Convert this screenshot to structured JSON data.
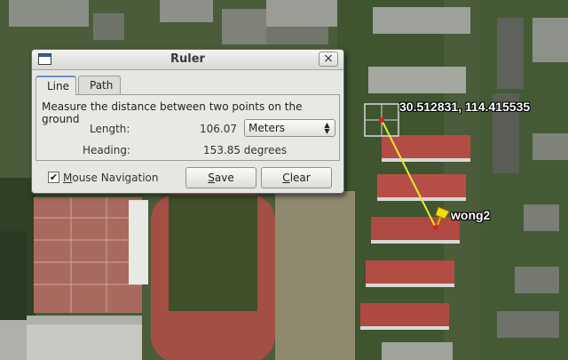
{
  "map": {
    "coordinate_label": "30.512831, 114.415535",
    "placemark_label": "wong2",
    "ruler_line_color": "#e8e830",
    "placemark_icon": "yellow-pushpin-icon"
  },
  "ruler": {
    "title": "Ruler",
    "window_icon": "window-icon",
    "close_icon": "close-icon",
    "tabs": [
      "Line",
      "Path"
    ],
    "active_tab": "Line",
    "description": "Measure the distance between two points on the ground",
    "length_label": "Length:",
    "length_value": "106.07",
    "units_selected": "Meters",
    "heading_label": "Heading:",
    "heading_value": "153.85 degrees",
    "mouse_nav_label": "Mouse Navigation",
    "mouse_nav_checked": "✔",
    "save_label": "Save",
    "clear_label": "Clear"
  }
}
